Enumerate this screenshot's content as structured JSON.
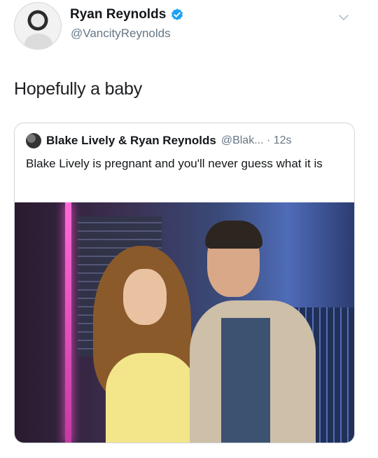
{
  "tweet": {
    "display_name": "Ryan Reynolds",
    "handle": "@VancityReynolds",
    "text": "Hopefully a baby",
    "verified": true,
    "icons": {
      "verified": "verified-badge-icon",
      "menu": "chevron-down-icon"
    }
  },
  "quoted_tweet": {
    "display_name": "Blake Lively & Ryan Reynolds",
    "handle_time": "@Blak... · 12s",
    "text": "Blake Lively is pregnant and you'll never guess what it is",
    "photo": "photo-couple-red-carpet"
  },
  "colors": {
    "accent_blue": "#1da1f2",
    "secondary_text": "#657786"
  }
}
